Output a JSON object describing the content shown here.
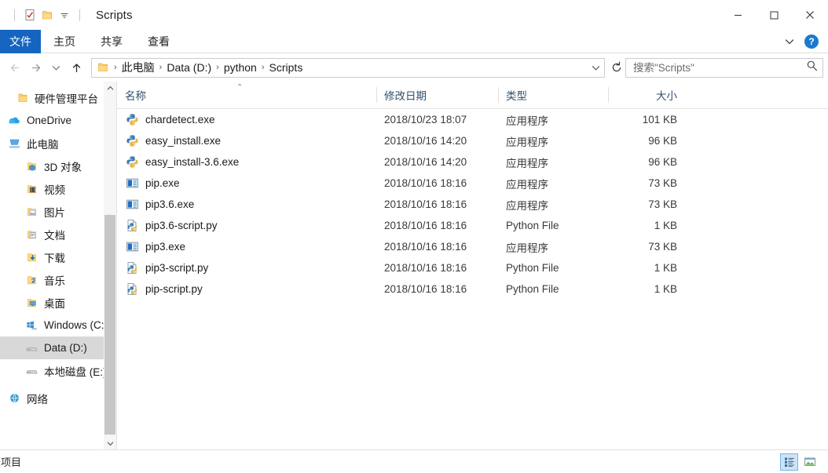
{
  "window": {
    "title": "Scripts",
    "quick_access": [
      {
        "name": "properties-icon",
        "label": "属性"
      },
      {
        "name": "new-folder-icon",
        "label": "新建文件夹"
      },
      {
        "name": "customize-qat-icon",
        "label": "自定义快速访问工具栏"
      }
    ],
    "controls": [
      {
        "name": "minimize-button",
        "glyph": "—"
      },
      {
        "name": "maximize-button",
        "glyph": "□"
      },
      {
        "name": "close-button",
        "glyph": "✕"
      }
    ]
  },
  "ribbon": {
    "file_tab": "文件",
    "tabs": [
      "主页",
      "共享",
      "查看"
    ],
    "expand_label": "展开功能区",
    "help_label": "?"
  },
  "addressbar": {
    "back_label": "后退",
    "forward_label": "前进",
    "recent_label": "最近浏览的位置",
    "up_label": "上移一级",
    "breadcrumbs": [
      "此电脑",
      "Data (D:)",
      "python",
      "Scripts"
    ],
    "dropdown_label": "以前的位置",
    "refresh_label": "刷新",
    "separator": "›"
  },
  "search": {
    "placeholder": "搜索\"Scripts\"",
    "value": "",
    "icon": "search-icon"
  },
  "sidebar": {
    "items": [
      {
        "label": "硬件管理平台",
        "icon": "folder-icon",
        "level": 1,
        "selected": false
      },
      {
        "label": "OneDrive",
        "icon": "onedrive-cloud-icon",
        "level": 0,
        "selected": false
      },
      {
        "label": "此电脑",
        "icon": "this-pc-icon",
        "level": 0,
        "selected": false
      },
      {
        "label": "3D 对象",
        "icon": "3d-objects-icon",
        "level": 1,
        "selected": false
      },
      {
        "label": "视频",
        "icon": "videos-icon",
        "level": 1,
        "selected": false
      },
      {
        "label": "图片",
        "icon": "pictures-icon",
        "level": 1,
        "selected": false
      },
      {
        "label": "文档",
        "icon": "documents-icon",
        "level": 1,
        "selected": false
      },
      {
        "label": "下载",
        "icon": "downloads-icon",
        "level": 1,
        "selected": false
      },
      {
        "label": "音乐",
        "icon": "music-icon",
        "level": 1,
        "selected": false
      },
      {
        "label": "桌面",
        "icon": "desktop-icon",
        "level": 1,
        "selected": false
      },
      {
        "label": "Windows (C:)",
        "icon": "windows-drive-icon",
        "level": 1,
        "selected": false
      },
      {
        "label": "Data (D:)",
        "icon": "drive-icon",
        "level": 1,
        "selected": true
      },
      {
        "label": "本地磁盘 (E:)",
        "icon": "drive-icon",
        "level": 1,
        "selected": false
      },
      {
        "label": "网络",
        "icon": "network-icon",
        "level": 0,
        "selected": false
      }
    ]
  },
  "filelist": {
    "columns": [
      {
        "label": "名称",
        "key": "name",
        "sorted": "asc"
      },
      {
        "label": "修改日期",
        "key": "date"
      },
      {
        "label": "类型",
        "key": "type"
      },
      {
        "label": "大小",
        "key": "size"
      }
    ],
    "sort_caret": "⌃",
    "rows": [
      {
        "name": "chardetect.exe",
        "date": "2018/10/23 18:07",
        "type": "应用程序",
        "size": "101 KB",
        "icon": "python-exe-icon"
      },
      {
        "name": "easy_install.exe",
        "date": "2018/10/16 14:20",
        "type": "应用程序",
        "size": "96 KB",
        "icon": "python-exe-icon"
      },
      {
        "name": "easy_install-3.6.exe",
        "date": "2018/10/16 14:20",
        "type": "应用程序",
        "size": "96 KB",
        "icon": "python-exe-icon"
      },
      {
        "name": "pip.exe",
        "date": "2018/10/16 18:16",
        "type": "应用程序",
        "size": "73 KB",
        "icon": "app-exe-icon"
      },
      {
        "name": "pip3.6.exe",
        "date": "2018/10/16 18:16",
        "type": "应用程序",
        "size": "73 KB",
        "icon": "app-exe-icon"
      },
      {
        "name": "pip3.6-script.py",
        "date": "2018/10/16 18:16",
        "type": "Python File",
        "size": "1 KB",
        "icon": "python-file-icon"
      },
      {
        "name": "pip3.exe",
        "date": "2018/10/16 18:16",
        "type": "应用程序",
        "size": "73 KB",
        "icon": "app-exe-icon"
      },
      {
        "name": "pip3-script.py",
        "date": "2018/10/16 18:16",
        "type": "Python File",
        "size": "1 KB",
        "icon": "python-file-icon"
      },
      {
        "name": "pip-script.py",
        "date": "2018/10/16 18:16",
        "type": "Python File",
        "size": "1 KB",
        "icon": "python-file-icon"
      }
    ]
  },
  "statusbar": {
    "item_count_text": "个项目",
    "views": [
      {
        "name": "details-view-button",
        "label": "详细信息",
        "active": true
      },
      {
        "name": "large-icons-view-button",
        "label": "大图标",
        "active": false
      }
    ]
  },
  "colors": {
    "accent": "#1565c0",
    "selection": "#d8d8d8",
    "header_text": "#31506e",
    "help_blue": "#1b79d0"
  }
}
